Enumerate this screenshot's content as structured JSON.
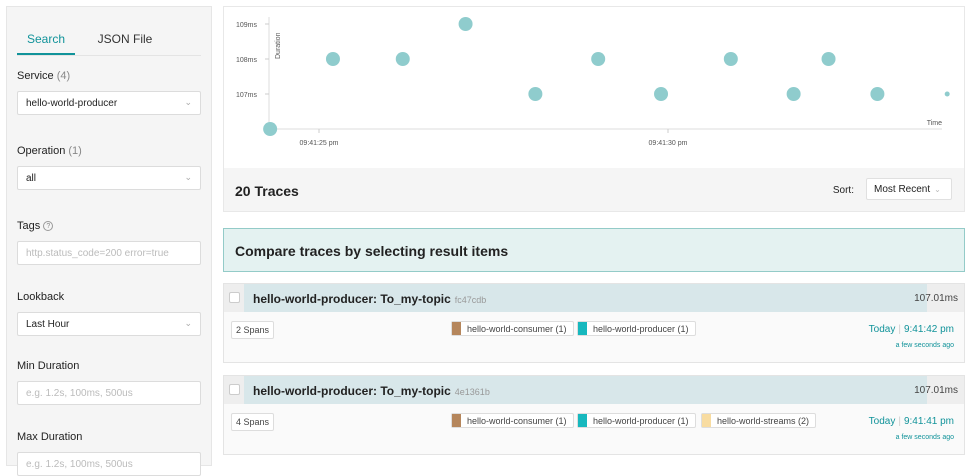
{
  "sidebar": {
    "tabs": [
      "Search",
      "JSON File"
    ],
    "service": {
      "label": "Service",
      "count": "(4)",
      "value": "hello-world-producer"
    },
    "operation": {
      "label": "Operation",
      "count": "(1)",
      "value": "all"
    },
    "tags": {
      "label": "Tags",
      "placeholder": "http.status_code=200 error=true"
    },
    "lookback": {
      "label": "Lookback",
      "value": "Last Hour"
    },
    "min_duration": {
      "label": "Min Duration",
      "placeholder": "e.g. 1.2s, 100ms, 500us"
    },
    "max_duration": {
      "label": "Max Duration",
      "placeholder": "e.g. 1.2s, 100ms, 500us"
    }
  },
  "chart_data": {
    "type": "scatter",
    "xlabel": "Time",
    "ylabel": "Duration",
    "x_ticks": [
      "09:41:25 pm",
      "09:41:30 pm"
    ],
    "y_ticks": [
      "107ms",
      "108ms",
      "109ms"
    ],
    "ylim": [
      106,
      109
    ],
    "color": "#8fcccd",
    "points": [
      {
        "time": "21:41:24.3",
        "duration_ms": 106
      },
      {
        "time": "21:41:25.2",
        "duration_ms": 108
      },
      {
        "time": "21:41:26.2",
        "duration_ms": 108
      },
      {
        "time": "21:41:27.1",
        "duration_ms": 109
      },
      {
        "time": "21:41:28.1",
        "duration_ms": 107
      },
      {
        "time": "21:41:29.0",
        "duration_ms": 108
      },
      {
        "time": "21:41:29.9",
        "duration_ms": 107
      },
      {
        "time": "21:41:30.9",
        "duration_ms": 108
      },
      {
        "time": "21:41:31.8",
        "duration_ms": 107
      },
      {
        "time": "21:41:32.3",
        "duration_ms": 108
      },
      {
        "time": "21:41:33.0",
        "duration_ms": 107
      },
      {
        "time": "21:41:34.0",
        "duration_ms": 107
      }
    ]
  },
  "results": {
    "count_label": "20 Traces",
    "sort_label": "Sort:",
    "sort_value": "Most Recent"
  },
  "compare_banner": "Compare traces by selecting result items",
  "traces": [
    {
      "name": "hello-world-producer: To_my-topic",
      "id": "fc47cdb",
      "duration": "107.01ms",
      "spans": "2 Spans",
      "services": [
        {
          "label": "hello-world-consumer (1)",
          "color": "#b5865c"
        },
        {
          "label": "hello-world-producer (1)",
          "color": "#17b8be"
        }
      ],
      "day": "Today",
      "time": "9:41:42 pm",
      "ago": "a few seconds ago"
    },
    {
      "name": "hello-world-producer: To_my-topic",
      "id": "4e1361b",
      "duration": "107.01ms",
      "spans": "4 Spans",
      "services": [
        {
          "label": "hello-world-consumer (1)",
          "color": "#b5865c"
        },
        {
          "label": "hello-world-producer (1)",
          "color": "#17b8be"
        },
        {
          "label": "hello-world-streams (2)",
          "color": "#f8dca1"
        }
      ],
      "day": "Today",
      "time": "9:41:41 pm",
      "ago": "a few seconds ago"
    }
  ]
}
